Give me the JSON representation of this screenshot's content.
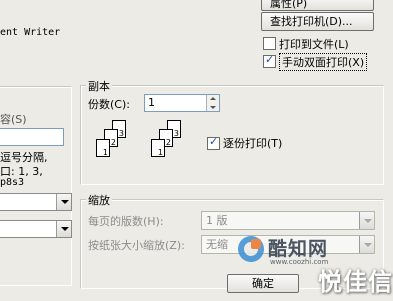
{
  "buttons": {
    "properties": "属性(P)",
    "find_printer": "查找打印机(D)...",
    "ok": "确定"
  },
  "printer": {
    "comment_value": "ent Writer"
  },
  "checkboxes": {
    "print_to_file": "打印到文件(L)",
    "print_to_file_checked": false,
    "manual_duplex": "手动双面打印(X)",
    "manual_duplex_checked": true
  },
  "page_range": {
    "label_partial": "容(S)",
    "hint_line1": "逗号分隔,",
    "hint_line2": "口: 1, 3,",
    "hint_line3": "p8s3"
  },
  "copies": {
    "group_title": "副本",
    "count_label": "份数(C):",
    "count_value": "1",
    "collate_label": "逐份打印(T)",
    "collate_checked": true,
    "collate_icons": [
      {
        "pages": [
          "3",
          "2",
          "1"
        ]
      },
      {
        "pages": [
          "3",
          "2",
          "1"
        ]
      }
    ]
  },
  "zoom": {
    "group_title": "缩放",
    "pages_per_sheet_label": "每页的版数(H):",
    "pages_per_sheet_value": "1 版",
    "scale_to_paper_label": "按纸张大小缩放(Z):",
    "scale_to_paper_value": "无缩"
  },
  "watermark": {
    "site_name": "酷知网",
    "site_url": "www.coozhi.com",
    "brand": "悦佳信"
  }
}
